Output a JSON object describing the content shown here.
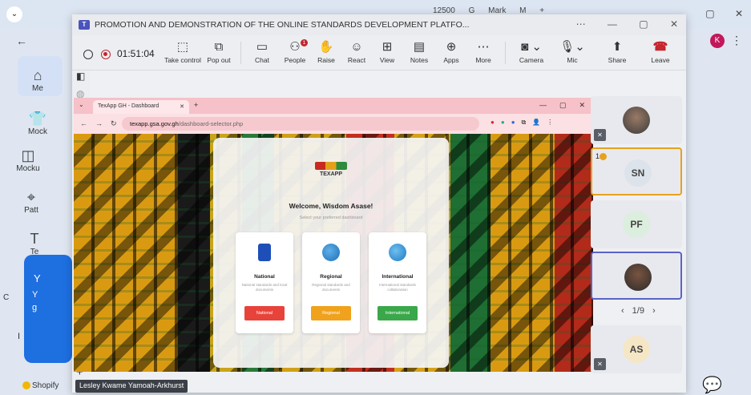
{
  "background_browser": {
    "tabs": [
      "12500",
      "G",
      "Mark",
      "M",
      "+"
    ],
    "profile_initial": "K",
    "sidebar": [
      {
        "label": "Me",
        "icon": "home-icon"
      },
      {
        "label": "Mock",
        "icon": "shirt-icon"
      },
      {
        "label": "Mocku",
        "icon": "box-icon"
      },
      {
        "label": "Patt",
        "icon": "pattern-icon"
      },
      {
        "label": "Te",
        "icon": "text-icon"
      }
    ],
    "card_letters": [
      "Y",
      "Y",
      "g",
      "I",
      "C"
    ],
    "bottom_label": "Shopify"
  },
  "meeting": {
    "title": "PROMOTION AND DEMONSTRATION OF THE ONLINE STANDARDS DEVELOPMENT PLATFO...",
    "timer": "01:51:04",
    "toolbar": [
      {
        "label": "Take control",
        "icon": "cursor-icon",
        "glyph": "⬚"
      },
      {
        "label": "Pop out",
        "icon": "popout-icon",
        "glyph": "⧉"
      },
      {
        "label": "Chat",
        "icon": "chat-icon",
        "glyph": "💬"
      },
      {
        "label": "People",
        "icon": "people-icon",
        "glyph": "👥",
        "badge": "1"
      },
      {
        "label": "Raise",
        "icon": "hand-icon",
        "glyph": "✋"
      },
      {
        "label": "React",
        "icon": "smiley-icon",
        "glyph": "☺"
      },
      {
        "label": "View",
        "icon": "grid-icon",
        "glyph": "⊞"
      },
      {
        "label": "Notes",
        "icon": "notes-icon",
        "glyph": "▤"
      },
      {
        "label": "Apps",
        "icon": "apps-icon",
        "glyph": "⊕"
      },
      {
        "label": "More",
        "icon": "more-icon",
        "glyph": "⋯"
      },
      {
        "label": "Camera",
        "icon": "camera-off-icon",
        "glyph": "🎥"
      },
      {
        "label": "Mic",
        "icon": "mic-off-icon",
        "glyph": "🎙"
      },
      {
        "label": "Share",
        "icon": "share-icon",
        "glyph": "⬆"
      },
      {
        "label": "Leave",
        "icon": "phone-hangup-icon",
        "glyph": "☎"
      }
    ],
    "presenter_name": "Lesley Kwame Yamoah-Arkhurst",
    "participants": [
      {
        "initials": "",
        "muted": true,
        "type": "photo"
      },
      {
        "initials": "SN",
        "muted": false,
        "raised": "1"
      },
      {
        "initials": "PF",
        "muted": false
      },
      {
        "initials": "",
        "muted": false,
        "type": "photo",
        "active": true
      },
      {
        "initials": "AS",
        "muted": true
      }
    ],
    "pager": "1/9"
  },
  "shared_screen": {
    "tab_title": "TexApp GH - Dashboard",
    "url_domain": "texapp.gsa.gov.gh",
    "url_path": "/dashboard-selector.php",
    "logo_text": "TEXAPP",
    "welcome": "Welcome, Wisdom Asase!",
    "subtitle": "Select your preferred dashboard",
    "cards": [
      {
        "title": "National",
        "desc": "National standards and local documents",
        "button": "National",
        "color": "#e8433a"
      },
      {
        "title": "Regional",
        "desc": "Regional standards and documents",
        "button": "Regional",
        "color": "#f0a21c"
      },
      {
        "title": "International",
        "desc": "International standards collaboration",
        "button": "International",
        "color": "#3aa84a"
      }
    ]
  }
}
